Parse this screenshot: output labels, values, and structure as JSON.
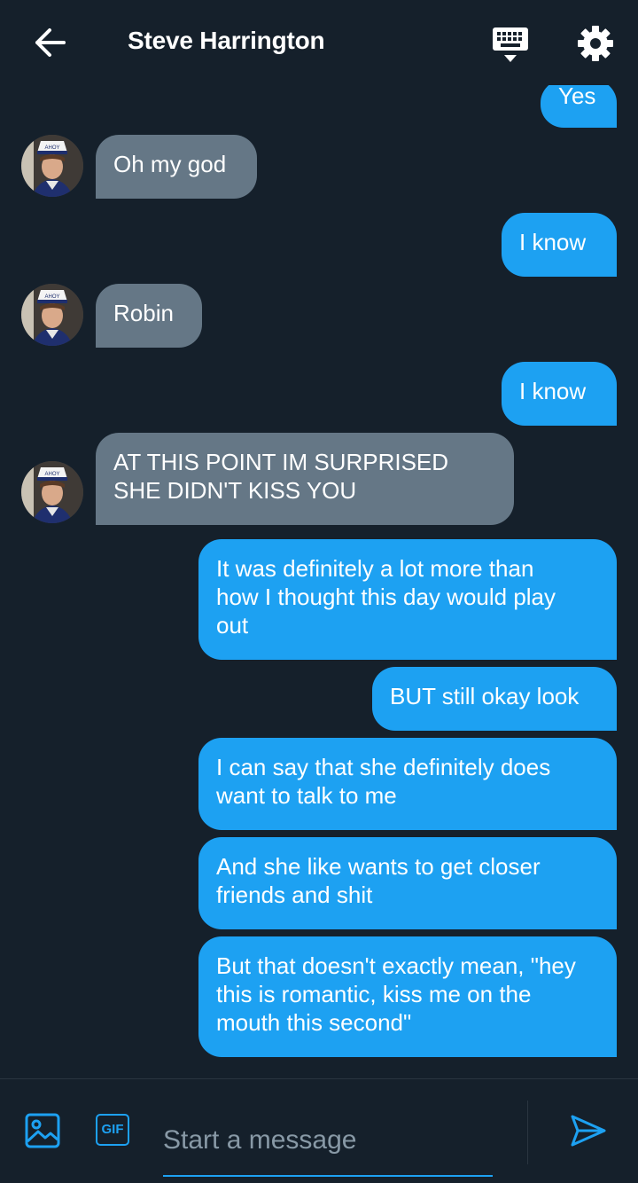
{
  "header": {
    "title": "Steve Harrington"
  },
  "messages": [
    {
      "from": "me",
      "text": "Yes"
    },
    {
      "from": "them",
      "text": "Oh my god"
    },
    {
      "from": "me",
      "text": "I know"
    },
    {
      "from": "them",
      "text": "Robin"
    },
    {
      "from": "me",
      "text": "I know"
    },
    {
      "from": "them",
      "text": "AT THIS POINT IM SURPRISED\nSHE DIDN'T KISS YOU"
    },
    {
      "from": "me",
      "text": "It was definitely a lot more than\nhow I thought this day would play\nout"
    },
    {
      "from": "me",
      "text": "BUT still okay look"
    },
    {
      "from": "me",
      "text": "I can say that she definitely does\nwant to talk to me"
    },
    {
      "from": "me",
      "text": "And she like wants to get closer\nfriends and shit"
    },
    {
      "from": "me",
      "text": "But that doesn't exactly mean, \"hey\nthis is romantic, kiss me on the\nmouth this second\""
    }
  ],
  "avatar": {
    "hat_text": "AHOY"
  },
  "composer": {
    "placeholder": "Start a message",
    "gif_label": "GIF"
  },
  "colors": {
    "background": "#15202b",
    "outgoing": "#1da1f2",
    "incoming": "#657786",
    "accent": "#1da1f2",
    "placeholder": "#8899a6"
  },
  "icons": {
    "back": "arrow-left-icon",
    "keyboard": "keyboard-icon",
    "settings": "gear-icon",
    "image": "image-icon",
    "send": "send-icon"
  }
}
